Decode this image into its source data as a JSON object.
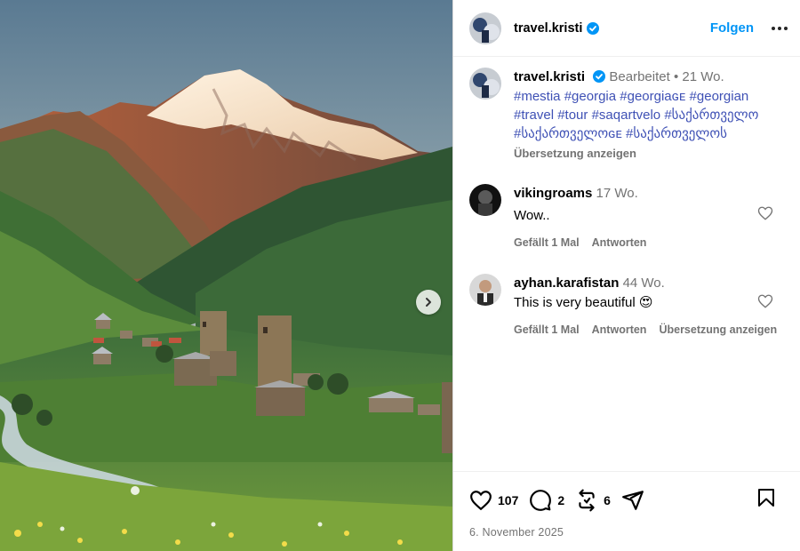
{
  "post": {
    "username": "travel.kristi",
    "follow_label": "Folgen",
    "edited_label": "Bearbeitet",
    "age": "21 Wo.",
    "caption_tags": [
      "#mestia",
      "#georgia",
      "#georgiaɢᴇ",
      "#georgian",
      "#travel",
      "#tour",
      "#saqartvelo",
      "#საქართველო",
      "#საქართველოɢᴇ",
      "#საქართველოს"
    ],
    "translate_label": "Übersetzung anzeigen"
  },
  "comments": [
    {
      "username": "vikingroams",
      "age": "17 Wo.",
      "text": "Wow..",
      "likes": "Gefällt 1 Mal",
      "reply": "Antworten"
    },
    {
      "username": "ayhan.karafistan",
      "age": "44 Wo.",
      "text": "This is very beautiful",
      "emoji": "😍",
      "likes": "Gefällt 1 Mal",
      "reply": "Antworten",
      "translate": "Übersetzung anzeigen"
    }
  ],
  "actions": {
    "likes": "107",
    "comments": "2",
    "reposts": "6"
  },
  "date": "6. November 2025",
  "colors": {
    "accent": "#0095f6",
    "verified": "#0095f6",
    "hashtag": "#3f51b5"
  }
}
